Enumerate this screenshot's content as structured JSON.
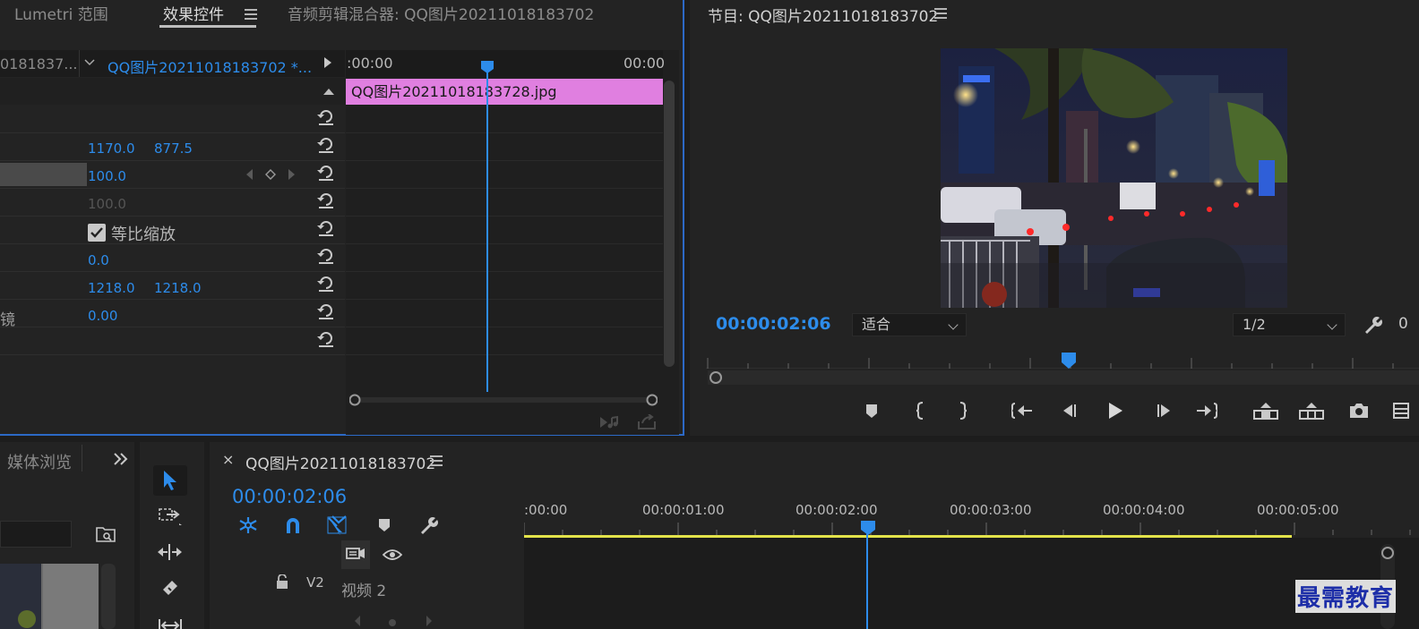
{
  "effect_controls": {
    "tabs": [
      "Lumetri 范围",
      "效果控件",
      "音频剪辑混合器: QQ图片20211018183702"
    ],
    "source_label": "0181837...",
    "clip_label": "QQ图片20211018183702 *...",
    "ruler_start": ":00:00",
    "ruler_end": "00:00",
    "clip_name": "QQ图片20211018183728.jpg",
    "position_x": "1170.0",
    "position_y": "877.5",
    "scale": "100.0",
    "scale_width": "100.0",
    "uniform_scale_label": "等比缩放",
    "rotation": "0.0",
    "anchor_x": "1218.0",
    "anchor_y": "1218.0",
    "antiflicker_label": "镜",
    "antiflicker_value": "0.00"
  },
  "program_monitor": {
    "title": "节目: QQ图片20211018183702",
    "timecode": "00:00:02:06",
    "fit_label": "适合",
    "resolution_label": "1/2",
    "extra_digit": "0"
  },
  "media_browser": {
    "title": "媒体浏览"
  },
  "sequence": {
    "title": "QQ图片20211018183702",
    "timecode": "00:00:02:06",
    "ruler_labels": [
      ":00:00",
      "00:00:01:00",
      "00:00:02:00",
      "00:00:03:00",
      "00:00:04:00",
      "00:00:05:00"
    ],
    "track_id": "V2",
    "track_name": "视频 2"
  },
  "watermark": "最需教育",
  "colors": {
    "accent_blue": "#2d8ceb",
    "clip_pink": "#e07fe0",
    "work_area_yellow": "#e3e34a",
    "panel_bg": "#232323"
  }
}
